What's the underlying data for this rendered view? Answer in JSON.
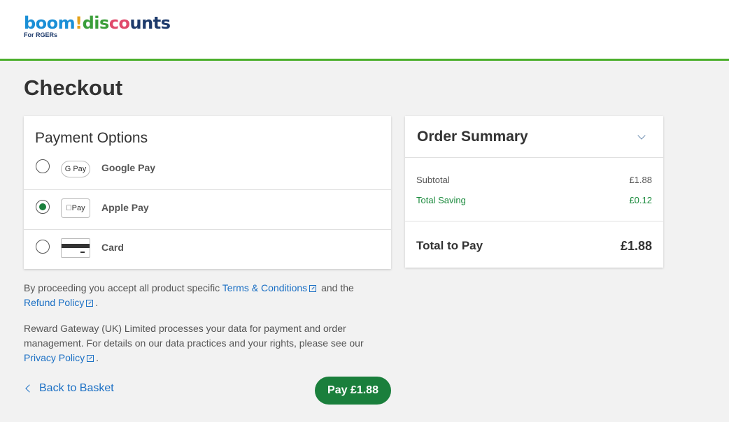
{
  "header": {
    "logo": {
      "part1": "boom",
      "part2": "!",
      "part3": "dis",
      "part4": "co",
      "part5": "unts",
      "tagline": "For RGERs"
    }
  },
  "page": {
    "title": "Checkout"
  },
  "payment": {
    "title": "Payment Options",
    "options": [
      {
        "label": "Google Pay",
        "logo_text": "G Pay",
        "selected": false
      },
      {
        "label": "Apple Pay",
        "logo_text": "Pay",
        "selected": true
      },
      {
        "label": "Card",
        "logo_text": "",
        "selected": false
      }
    ]
  },
  "summary": {
    "title": "Order Summary",
    "subtotal_label": "Subtotal",
    "subtotal_value": "£1.88",
    "saving_label": "Total Saving",
    "saving_value": "£0.12",
    "total_label": "Total to Pay",
    "total_value": "£1.88"
  },
  "legal": {
    "p1_a": "By proceeding you accept all product specific ",
    "terms_link": "Terms & Conditions",
    "p1_b": " and the",
    "refund_link": "Refund Policy",
    "p1_c": ".",
    "p2_a": "Reward Gateway (UK) Limited processes your data for payment and order management. For details on our data practices and your rights, please see our ",
    "privacy_link": "Privacy Policy",
    "p2_b": "."
  },
  "actions": {
    "back_label": "Back to Basket",
    "pay_label": "Pay £1.88"
  },
  "colors": {
    "accent_green": "#1a7f3c",
    "header_rule": "#4caf2c",
    "link_blue": "#1a6fc4",
    "saving_green": "#1a8a3c"
  }
}
